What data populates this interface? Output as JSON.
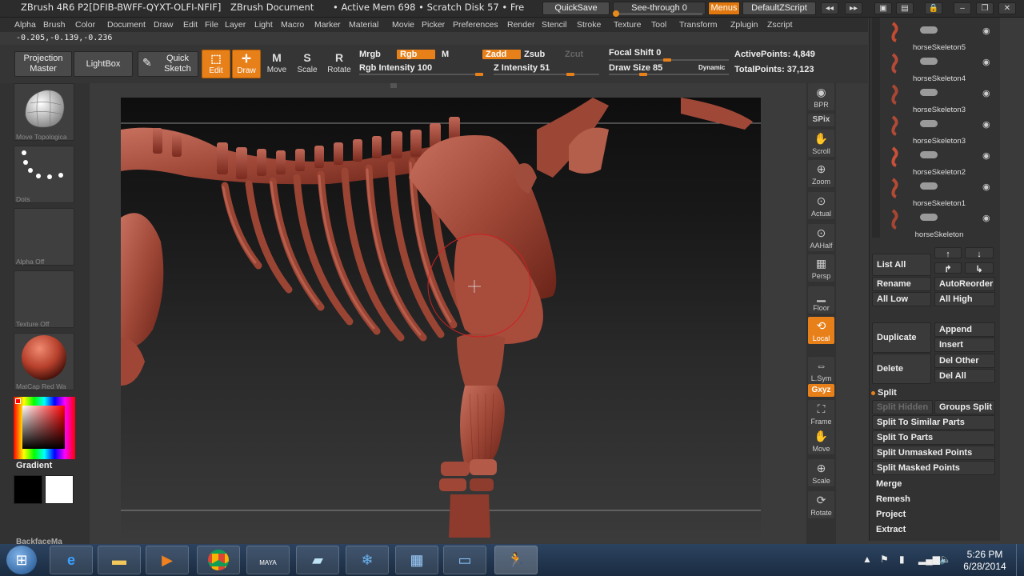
{
  "title": {
    "app": "ZBrush 4R6  P2[DFIB-BWFF-QYXT-OLFI-NFIF]",
    "doc": "ZBrush Document",
    "mem": "• Active Mem 698  • Scratch Disk 57  • Fre",
    "quicksave": "QuickSave",
    "seethrough": "See-through  0",
    "menus": "Menus",
    "defaultscript": "DefaultZScript"
  },
  "menu": [
    "Alpha",
    "Brush",
    "Color",
    "Document",
    "Draw",
    "Edit",
    "File",
    "Layer",
    "Light",
    "Macro",
    "Marker",
    "Material",
    "Movie",
    "Picker",
    "Preferences",
    "Render",
    "Stencil",
    "Stroke",
    "Texture",
    "Tool",
    "Transform",
    "Zplugin",
    "Zscript"
  ],
  "coords": "-0.205,-0.139,-0.236",
  "shelf": {
    "projection_master": "Projection Master",
    "lightbox": "LightBox",
    "quick_sketch": "Quick Sketch",
    "edit": "Edit",
    "draw": "Draw",
    "move": "Move",
    "scale": "Scale",
    "rotate": "Rotate",
    "mrgb": "Mrgb",
    "rgb": "Rgb",
    "m": "M",
    "zadd": "Zadd",
    "zsub": "Zsub",
    "zcut": "Zcut",
    "rgb_intensity": "Rgb  Intensity 100",
    "z_intensity": "Z  Intensity 51",
    "focal_shift": "Focal  Shift  0",
    "draw_size": "Draw  Size  85",
    "dynamic": "Dynamic",
    "active_points": "ActivePoints:  4,849",
    "total_points": "TotalPoints:  37,123",
    "rgb_intensity_value": 100,
    "z_intensity_value": 51,
    "draw_size_value": 85
  },
  "left": {
    "brush_caption": "Move Topologica",
    "stroke_caption": "Dots",
    "alpha_caption": "Alpha  Off",
    "texture_caption": "Texture  Off",
    "material_caption": "MatCap  Red  Wa",
    "gradient": "Gradient",
    "partial": "BackfaceMa"
  },
  "right": [
    {
      "label": "BPR",
      "glyph": "◉"
    },
    {
      "label": "SPix",
      "glyph": ""
    },
    {
      "label": "Scroll",
      "glyph": "✋"
    },
    {
      "label": "Zoom",
      "glyph": "⊕"
    },
    {
      "label": "Actual",
      "glyph": "⊙"
    },
    {
      "label": "AAHalf",
      "glyph": "⊙"
    },
    {
      "label": "Persp",
      "glyph": "▦"
    },
    {
      "label": "Floor",
      "glyph": "▁"
    },
    {
      "label": "Local",
      "glyph": "⟲"
    },
    {
      "label": "L.Sym",
      "glyph": "⇔"
    },
    {
      "label": "Gxyz",
      "glyph": ""
    },
    {
      "label": "Frame",
      "glyph": "⛶"
    },
    {
      "label": "Move",
      "glyph": "✋"
    },
    {
      "label": "Scale",
      "glyph": "⊕"
    },
    {
      "label": "Rotate",
      "glyph": "⟳"
    }
  ],
  "subtools": [
    "horseSkeleton5",
    "horseSkeleton4",
    "horseSkeleton3",
    "horseSkeleton3",
    "horseSkeleton2",
    "horseSkeleton1",
    "horseSkeleton"
  ],
  "panel": {
    "list_all": "List  All",
    "rename": "Rename",
    "autoreorder": "AutoReorder",
    "all_low": "All  Low",
    "all_high": "All  High",
    "duplicate": "Duplicate",
    "append": "Append",
    "insert": "Insert",
    "delete": "Delete",
    "del_other": "Del  Other",
    "del_all": "Del  All",
    "split": "Split",
    "split_hidden": "Split  Hidden",
    "groups_split": "Groups  Split",
    "split_similar": "Split  To  Similar  Parts",
    "split_parts": "Split  To  Parts",
    "split_unmasked": "Split  Unmasked  Points",
    "split_masked": "Split  Masked  Points",
    "merge": "Merge",
    "remesh": "Remesh",
    "project": "Project",
    "extract": "Extract"
  },
  "taskbar": {
    "time": "5:26 PM",
    "date": "6/28/2014",
    "maya": "MAYA"
  },
  "colors": {
    "accent": "#e8801a",
    "mesh": "#a34a3c",
    "bg": "#3a3a3a"
  }
}
